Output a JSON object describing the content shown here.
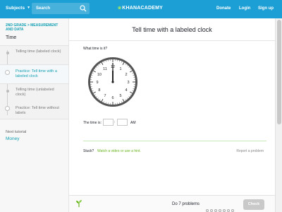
{
  "header": {
    "subjects_label": "Subjects",
    "search_placeholder": "Search",
    "logo_text": "KHANACADEMY",
    "links": [
      "Donate",
      "Login",
      "Sign up"
    ],
    "brand_color": "#1c9fd4"
  },
  "sidebar": {
    "breadcrumb": "2ND GRADE > MEASUREMENT AND DATA",
    "title": "Time",
    "items": [
      {
        "label": "Telling time (labeled clock)",
        "active": false
      },
      {
        "label": "Practice: Tell time with a labeled clock",
        "active": true
      },
      {
        "label": "Telling time (unlabeled clock)",
        "active": false
      },
      {
        "label": "Practice: Tell time without labels",
        "active": false
      }
    ],
    "next_label": "Next tutorial",
    "next_title": "Money"
  },
  "exercise": {
    "title": "Tell time with a labeled clock",
    "question": "What time is it?",
    "clock_numbers": [
      "12",
      "1",
      "2",
      "3",
      "4",
      "5",
      "6",
      "7",
      "8",
      "9",
      "10",
      "11"
    ],
    "clock_time": {
      "hour": 12,
      "minute": 0
    },
    "time_label": "The time is:",
    "separator": ":",
    "period": "AM",
    "hour_value": "",
    "minute_value": "",
    "stuck_label": "Stuck?",
    "stuck_link": "Watch a video or use a hint.",
    "report_label": "Report a problem"
  },
  "footer": {
    "do_label": "Do 7 problems",
    "progress_total": 7,
    "check_label": "Check",
    "accent_color": "#67b51c"
  }
}
